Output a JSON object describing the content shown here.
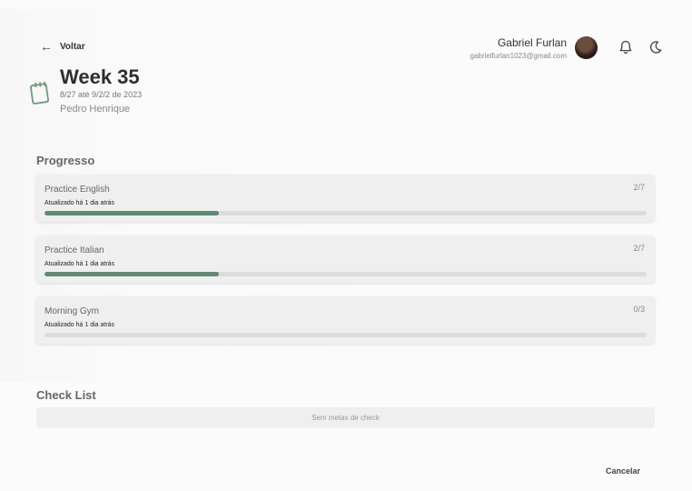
{
  "header": {
    "back_label": "Voltar",
    "user_name": "Gabriel Furlan",
    "user_email": "gabrielfurlan1023@gmail.com"
  },
  "week": {
    "title": "Week 35",
    "date_range": "8/27 até 9/2/2 de 2023",
    "owner": "Pedro Henrique"
  },
  "progress": {
    "title": "Progresso",
    "items": [
      {
        "name": "Practice English",
        "count": "2/7",
        "updated": "Atualizado há 1 dia atrás",
        "fraction": 0.29
      },
      {
        "name": "Practice Italian",
        "count": "2/7",
        "updated": "Atualizado há 1 dia atrás",
        "fraction": 0.29
      },
      {
        "name": "Morning Gym",
        "count": "0/3",
        "updated": "Atualizado há 1 dia atrás",
        "fraction": 0
      }
    ]
  },
  "checklist": {
    "title": "Check List",
    "empty_text": "Sem metas de check"
  },
  "footer": {
    "cancel_label": "Cancelar"
  },
  "colors": {
    "accent": "#5e8b72",
    "card_bg": "#efefef"
  }
}
